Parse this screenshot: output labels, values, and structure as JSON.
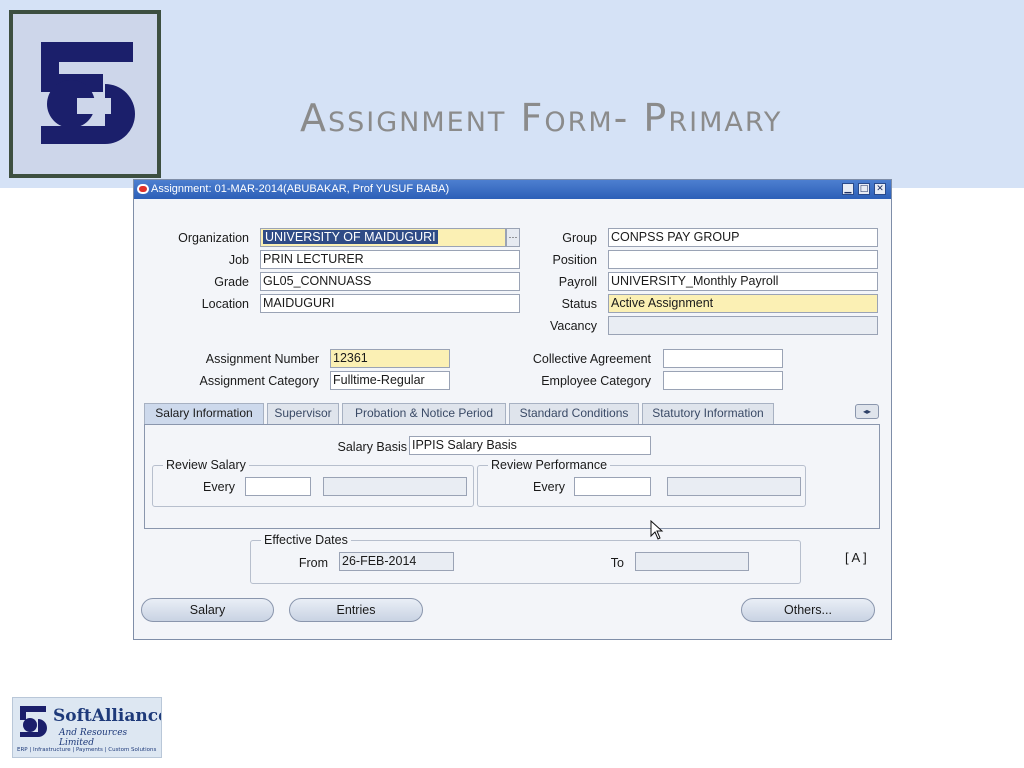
{
  "slide": {
    "title": "Assignment  Form- Primary"
  },
  "window": {
    "title": "Assignment: 01-MAR-2014(ABUBAKAR, Prof YUSUF BABA)",
    "controls": [
      "▁",
      "□",
      "✕"
    ]
  },
  "form": {
    "organization": {
      "label": "Organization",
      "value": "UNIVERSITY OF MAIDUGURI",
      "lov_label": "···"
    },
    "job": {
      "label": "Job",
      "value": "PRIN LECTURER"
    },
    "grade": {
      "label": "Grade",
      "value": "GL05_CONNUASS"
    },
    "location": {
      "label": "Location",
      "value": "MAIDUGURI"
    },
    "group": {
      "label": "Group",
      "value": "CONPSS PAY GROUP"
    },
    "position": {
      "label": "Position",
      "value": ""
    },
    "payroll": {
      "label": "Payroll",
      "value": "UNIVERSITY_Monthly Payroll"
    },
    "status": {
      "label": "Status",
      "value": "Active Assignment"
    },
    "vacancy": {
      "label": "Vacancy",
      "value": ""
    },
    "assignment_number": {
      "label": "Assignment Number",
      "value": "12361"
    },
    "assignment_category": {
      "label": "Assignment Category",
      "value": "Fulltime-Regular"
    },
    "collective_agreement": {
      "label": "Collective Agreement",
      "value": ""
    },
    "employee_category": {
      "label": "Employee Category",
      "value": ""
    }
  },
  "tabs": [
    {
      "label": "Salary Information",
      "active": true
    },
    {
      "label": "Supervisor",
      "active": false
    },
    {
      "label": "Probation & Notice Period",
      "active": false
    },
    {
      "label": "Standard Conditions",
      "active": false
    },
    {
      "label": "Statutory Information",
      "active": false
    }
  ],
  "salary_panel": {
    "salary_basis_label": "Salary Basis",
    "salary_basis_value": "IPPIS Salary Basis",
    "review_salary": {
      "title": "Review Salary",
      "every_label": "Every",
      "every_value": "",
      "unit_value": ""
    },
    "review_performance": {
      "title": "Review Performance",
      "every_label": "Every",
      "every_value": "",
      "unit_value": ""
    }
  },
  "effective_dates": {
    "title": "Effective Dates",
    "from_label": "From",
    "from_value": "26-FEB-2014",
    "to_label": "To",
    "to_value": ""
  },
  "attachment_indicator": "[ A ]",
  "buttons": {
    "salary": "Salary",
    "entries": "Entries",
    "others": "Others..."
  },
  "company_logo": {
    "name": "SoftAlliance",
    "subtitle": "And Resources Limited",
    "tagline": "ERP | Infrastructure | Payments | Custom Solutions"
  },
  "colors": {
    "title_bar": "#2c5fb7",
    "required_field": "#fbf0b4",
    "selection": "#2f4b86",
    "header_band": "#d5e2f6"
  }
}
